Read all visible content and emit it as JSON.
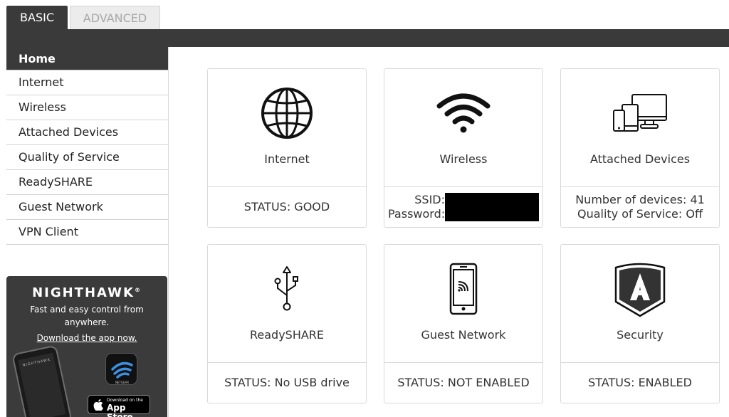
{
  "tabs": {
    "basic": "BASIC",
    "advanced": "ADVANCED"
  },
  "sidebar": {
    "items": [
      {
        "label": "Home",
        "active": true
      },
      {
        "label": "Internet"
      },
      {
        "label": "Wireless"
      },
      {
        "label": "Attached Devices"
      },
      {
        "label": "Quality of Service"
      },
      {
        "label": "ReadySHARE"
      },
      {
        "label": "Guest Network"
      },
      {
        "label": "VPN Client"
      }
    ]
  },
  "promo": {
    "brand": "NIGHTHAWK",
    "text": "Fast and easy control from anywhere.",
    "link": "Download the app now.",
    "store_small": "Download on the",
    "store_big": "App Store"
  },
  "cards": {
    "internet": {
      "title": "Internet",
      "status": "STATUS: GOOD",
      "icon": "globe-icon"
    },
    "wireless": {
      "title": "Wireless",
      "ssid_label": "SSID:",
      "password_label": "Password:",
      "icon": "wifi-icon"
    },
    "attached": {
      "title": "Attached Devices",
      "line1": "Number of devices: 41",
      "line2": "Quality of Service: Off",
      "icon": "devices-icon"
    },
    "readyshare": {
      "title": "ReadySHARE",
      "status": "STATUS: No USB drive",
      "icon": "usb-icon"
    },
    "guest": {
      "title": "Guest Network",
      "status": "STATUS: NOT ENABLED",
      "icon": "mobile-wifi-icon"
    },
    "security": {
      "title": "Security",
      "status": "STATUS: ENABLED",
      "icon": "shield-a-icon"
    }
  }
}
